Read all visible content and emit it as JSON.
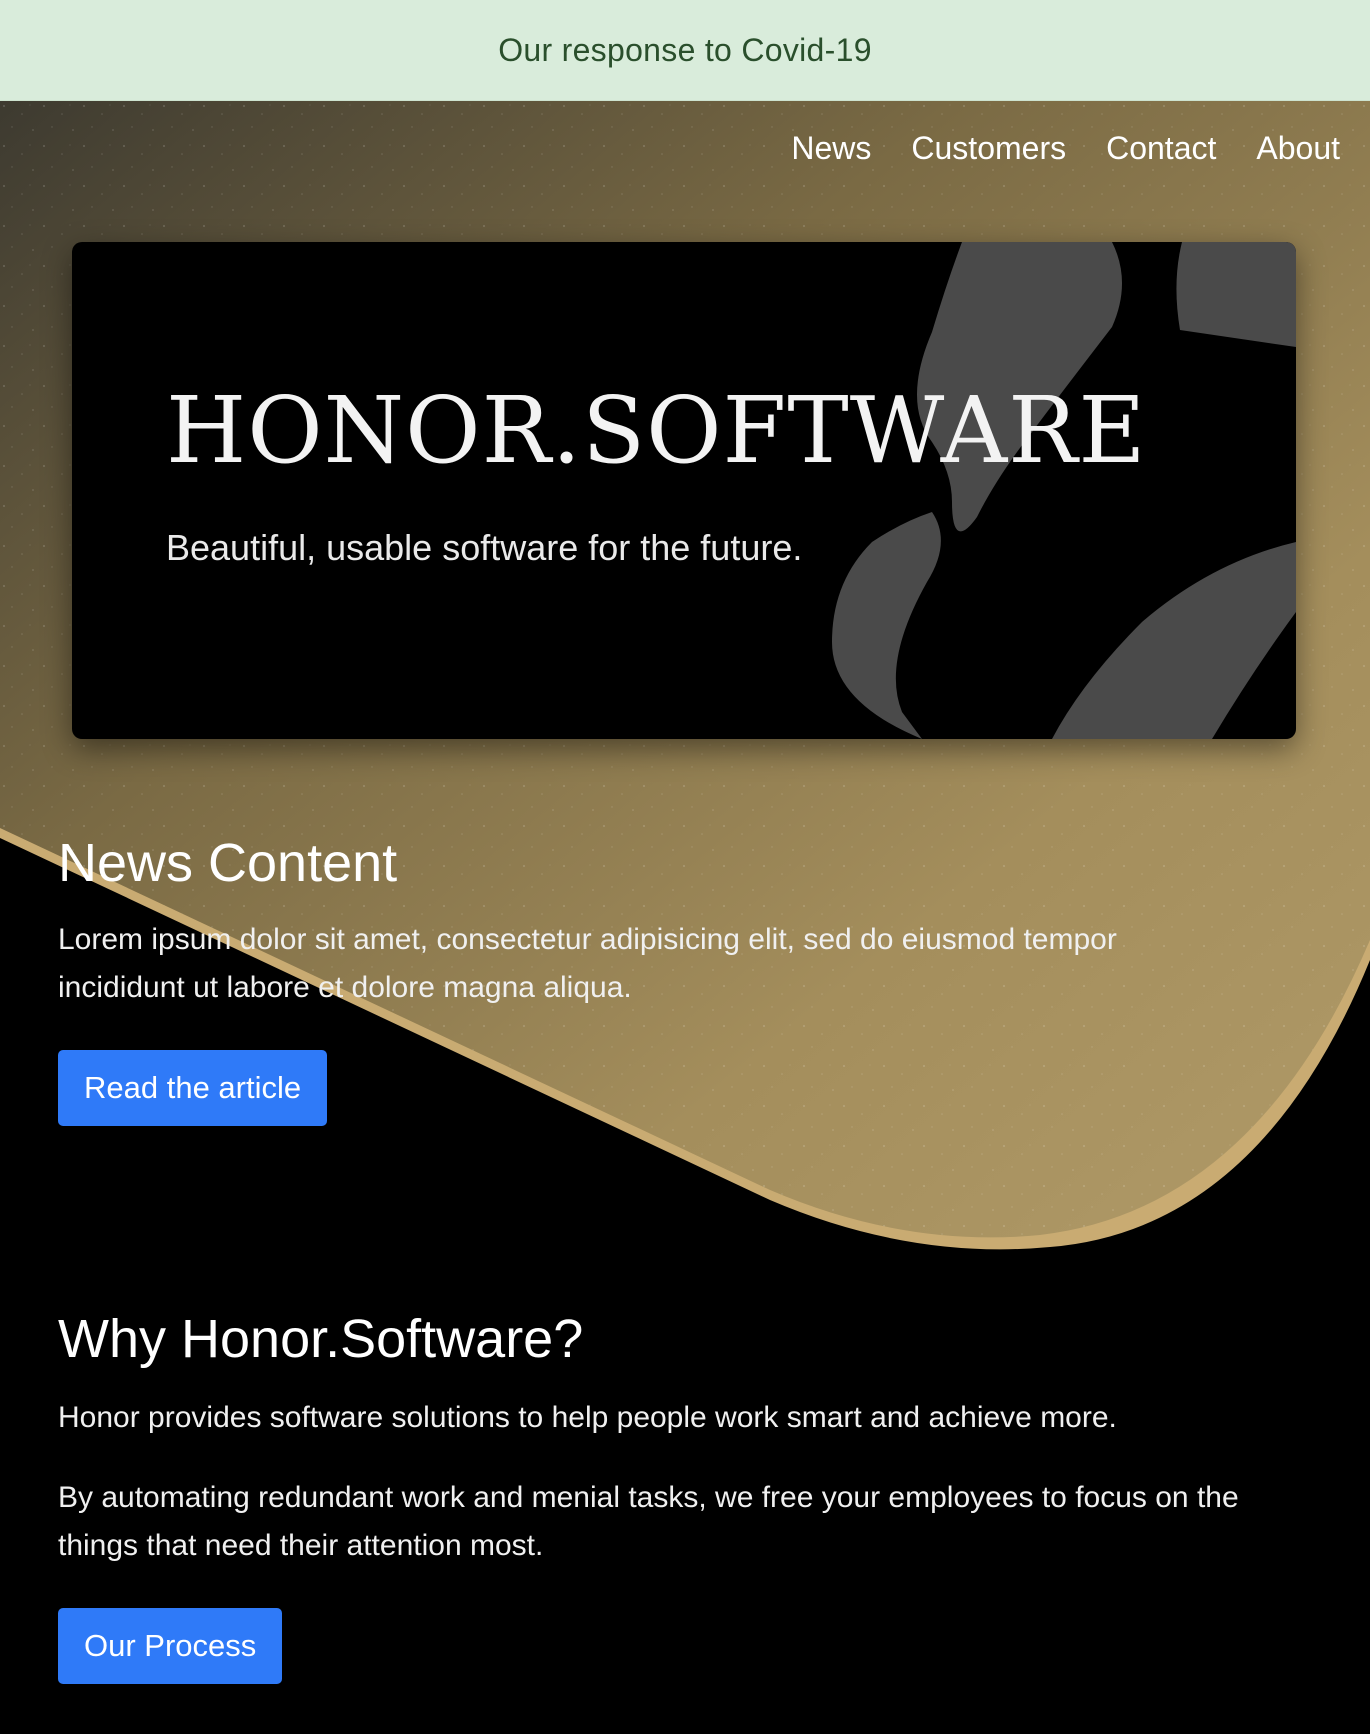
{
  "banner": {
    "link_label": "Our response to Covid-19"
  },
  "nav": {
    "items": [
      {
        "label": "News"
      },
      {
        "label": "Customers"
      },
      {
        "label": "Contact"
      },
      {
        "label": "About"
      }
    ]
  },
  "brand": {
    "title": "HONOR.SOFTWARE",
    "tagline": "Beautiful, usable software for the future."
  },
  "news": {
    "heading": "News Content",
    "body": "Lorem ipsum dolor sit amet, consectetur adipisicing elit, sed do eiusmod tempor incididunt ut labore et dolore magna aliqua.",
    "button_label": "Read the article"
  },
  "why": {
    "heading": "Why Honor.Software?",
    "paragraph1": "Honor provides software solutions to help people work smart and achieve more.",
    "paragraph2": "By automating redundant work and menial tasks, we free your employees to focus on the things that need their attention most.",
    "button_label": "Our Process"
  },
  "colors": {
    "banner_bg": "#d9ecdb",
    "banner_text": "#2a4f2c",
    "button_bg": "#2f7af8",
    "gold_accent": "#c9ab72",
    "page_bg": "#000000"
  }
}
